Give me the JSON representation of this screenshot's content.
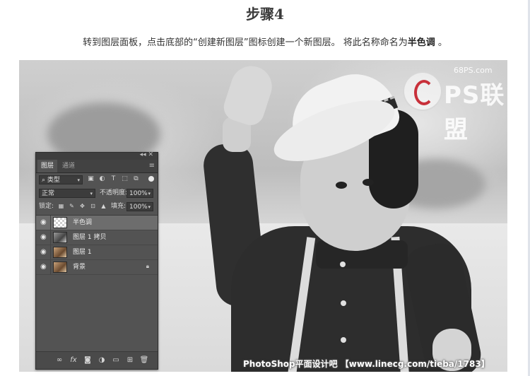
{
  "step_title": "步骤4",
  "instruction": {
    "text_before": "转到图层面板，点击底部的“创建新图层”图标创建一个新图层。 将此名称命名为",
    "layer_name_bold": "半色调",
    "text_after": " 。"
  },
  "photo": {
    "logo_site": "68PS.com",
    "logo_text": "PS联盟",
    "watermark": "PhotoShop平面设计吧 【www.linecg.com/tieba/1783】"
  },
  "layers_panel": {
    "close_glyph": "◂◂ ✕",
    "menu_glyph": "≡",
    "tabs": [
      {
        "label": "图层",
        "active": true
      },
      {
        "label": "通道",
        "active": false
      }
    ],
    "filter": {
      "kind_label": "类型",
      "icons": [
        "image-filter-icon",
        "adjustment-filter-icon",
        "type-filter-icon",
        "shape-filter-icon",
        "smart-object-filter-icon"
      ]
    },
    "blend": {
      "mode": "正常",
      "opacity_label": "不透明度:",
      "opacity_value": "100%"
    },
    "lock": {
      "label": "锁定:",
      "fill_label": "填充:",
      "fill_value": "100%"
    },
    "layers": [
      {
        "name": "半色调",
        "thumb": "transparent",
        "selected": true,
        "locked": false
      },
      {
        "name": "图层 1 拷贝",
        "thumb": "grayscale",
        "selected": false,
        "locked": false
      },
      {
        "name": "图层 1",
        "thumb": "color",
        "selected": false,
        "locked": false
      },
      {
        "name": "背景",
        "thumb": "color",
        "selected": false,
        "locked": true
      }
    ],
    "bottom_icons": [
      "link-layers-icon",
      "fx-icon",
      "add-mask-icon",
      "adjustment-layer-icon",
      "new-group-icon",
      "new-layer-icon",
      "delete-icon"
    ]
  }
}
